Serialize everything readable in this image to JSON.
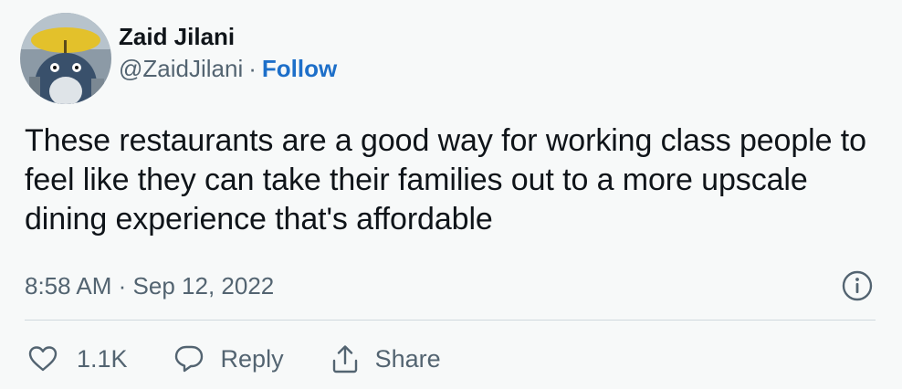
{
  "author": {
    "display_name": "Zaid Jilani",
    "handle": "@ZaidJilani",
    "separator": "·",
    "follow_label": "Follow"
  },
  "tweet": {
    "text": "These restaurants are a good way for working class people to feel like they can take their families out to a more upscale dining experience that's affordable",
    "time": "8:58 AM",
    "date_separator": "·",
    "date": "Sep 12, 2022"
  },
  "actions": {
    "like_count": "1.1K",
    "reply_label": "Reply",
    "share_label": "Share"
  },
  "icons": {
    "avatar": "avatar-image",
    "info": "info-icon",
    "like": "heart-icon",
    "reply": "reply-bubble-icon",
    "share": "share-icon"
  },
  "colors": {
    "background": "#f7f9f9",
    "text": "#0f1419",
    "secondary": "#536471",
    "link": "#1d6fc9",
    "divider": "#cfd9de"
  }
}
